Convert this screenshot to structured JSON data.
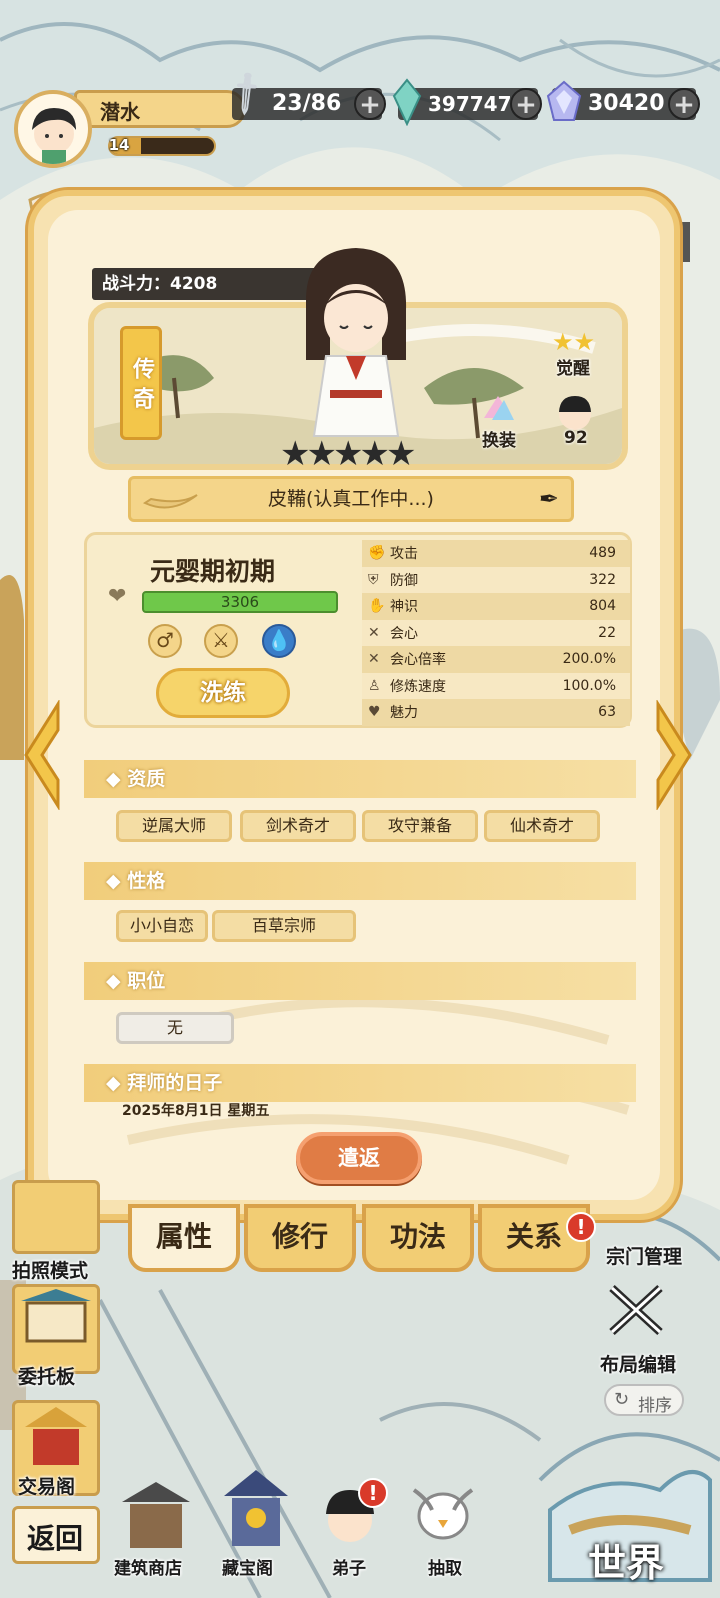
{
  "player": {
    "name": "潜水",
    "level": "14",
    "level_progress": 0.3
  },
  "resources": {
    "stamina": "23/86",
    "jade": "397747",
    "crystal": "30420"
  },
  "character": {
    "power_label": "战斗力：4208",
    "rarity": "传奇",
    "stars": 5,
    "awaken_label": "觉醒",
    "outfit_label": "换装",
    "likes": "92",
    "status": "皮鞴(认真工作中...)",
    "realm": "元婴期初期",
    "hp": "3306",
    "refine_label": "洗练",
    "dismiss_label": "遣返"
  },
  "stats": [
    {
      "label": "攻击",
      "value": "489",
      "icon": "fist-icon"
    },
    {
      "label": "防御",
      "value": "322",
      "icon": "shield-icon"
    },
    {
      "label": "神识",
      "value": "804",
      "icon": "hand-icon"
    },
    {
      "label": "会心",
      "value": "22",
      "icon": "cross-swords-icon"
    },
    {
      "label": "会心倍率",
      "value": "200.0%",
      "icon": "crit-icon"
    },
    {
      "label": "修炼速度",
      "value": "100.0%",
      "icon": "meditate-icon"
    },
    {
      "label": "魅力",
      "value": "63",
      "icon": "heart-icon"
    }
  ],
  "sections": {
    "aptitude": {
      "title": "◆ 资质",
      "tags": [
        "逆属大师",
        "剑术奇才",
        "攻守兼备",
        "仙术奇才"
      ]
    },
    "personality": {
      "title": "◆ 性格",
      "tags": [
        "小小自恋",
        "百草宗师"
      ]
    },
    "position": {
      "title": "◆ 职位",
      "tags": [
        "无"
      ]
    },
    "apprentice": {
      "title": "◆ 拜师的日子",
      "date": "2025年8月1日 星期五"
    }
  },
  "tabs": [
    {
      "label": "属性",
      "active": true
    },
    {
      "label": "修行",
      "active": false
    },
    {
      "label": "功法",
      "active": false
    },
    {
      "label": "关系",
      "active": false,
      "alert": "!"
    }
  ],
  "side_left": [
    {
      "label": "拍照模式"
    },
    {
      "label": "委托板"
    },
    {
      "label": "交易阁"
    },
    {
      "label": "返回"
    }
  ],
  "side_right": [
    {
      "label": "宗门管理"
    },
    {
      "label": "布局编辑"
    },
    {
      "label": "排序"
    }
  ],
  "bottom_nav": [
    {
      "label": "建筑商店"
    },
    {
      "label": "藏宝阁"
    },
    {
      "label": "弟子",
      "alert": "!"
    },
    {
      "label": "抽取"
    },
    {
      "label": "世界"
    }
  ],
  "colors": {
    "panel": "#f7e2b1",
    "accent": "#f4d58a",
    "dismiss": "#e07c45",
    "hp": "#6fc84a",
    "alert": "#d93a2a"
  }
}
